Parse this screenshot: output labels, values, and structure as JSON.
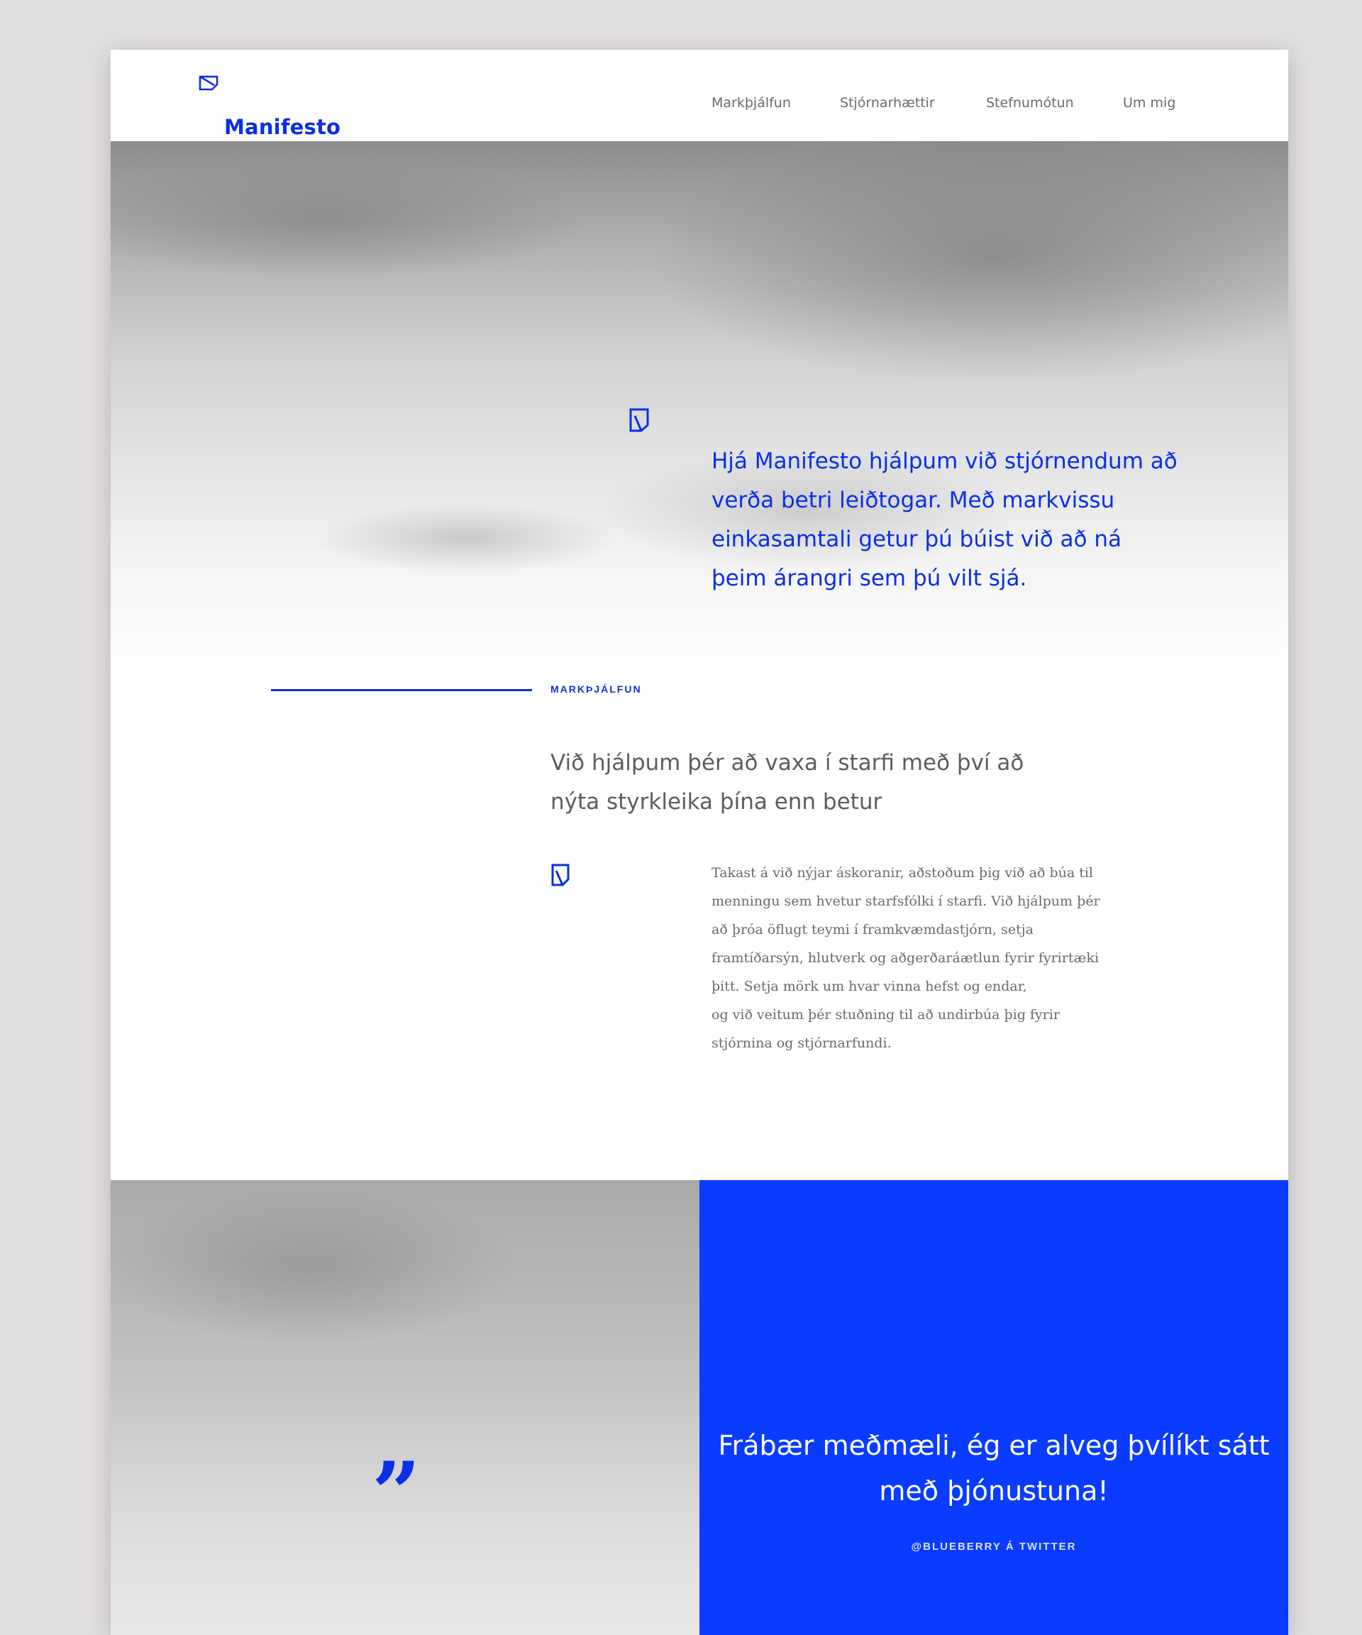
{
  "brand": {
    "name": "Manifesto",
    "accent_color": "#0a2fe6",
    "quote_panel_color": "#0a3cff"
  },
  "header": {
    "logo_icon": "folded-note-icon",
    "nav": [
      {
        "label": "Markþjálfun"
      },
      {
        "label": "Stjórnarhættir"
      },
      {
        "label": "Stefnumótun"
      },
      {
        "label": "Um mig"
      }
    ]
  },
  "hero": {
    "icon": "folded-note-icon",
    "text": "Hjá Manifesto hjálpum við stjórnendum að verða betri leiðtogar. Með markvissu einkasamtali getur þú búist við að ná þeim árangri sem þú vilt sjá."
  },
  "section": {
    "label": "MARKÞJÁLFUN",
    "heading": "Við hjálpum þér að vaxa í starfi með því að nýta styrkleika þína enn betur",
    "icon": "folded-note-icon",
    "body_lines": [
      "Takast á við nýjar áskoranir, aðstoðum þig við að búa til",
      "menningu sem hvetur starfsfólki í starfi. Við hjálpum þér",
      "að þróa öflugt teymi í framkvæmdastjórn, setja",
      "framtíðarsýn, hlutverk og aðgerðaráætlun fyrir fyrirtæki",
      "þitt. Setja mörk um hvar vinna hefst og endar,",
      "og við veitum þér  stuðning til að undirbúa þig fyrir",
      "stjórnina og stjórnarfundi."
    ]
  },
  "testimonial": {
    "quote_mark": "”",
    "text": "Frábær meðmæli, ég er alveg þvílíkt sátt með þjónustuna!",
    "attribution": "@BLUEBERRY Á TWITTER"
  }
}
